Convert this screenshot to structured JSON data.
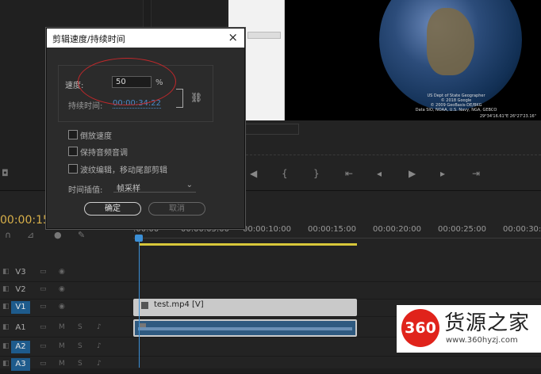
{
  "dialog": {
    "title": "剪辑速度/持续时间",
    "close": "×",
    "speed_label": "速度:",
    "speed_value": "50",
    "speed_unit": "%",
    "duration_label": "持续时间:",
    "duration_value": "00:00:34:22",
    "options": [
      {
        "label": "倒放速度",
        "checked": false
      },
      {
        "label": "保持音频音调",
        "checked": false
      },
      {
        "label": "波纹编辑，移动尾部剪辑",
        "checked": false
      }
    ],
    "interp_label": "时间插值:",
    "interp_value": "帧采样",
    "ok_label": "确定",
    "cancel_label": "取消"
  },
  "timeline": {
    "current_time": "00:00:15",
    "ruler": [
      ":00:00",
      "00:00:05:00",
      "00:00:10:00",
      "00:00:15:00",
      "00:00:20:00",
      "00:00:25:00",
      "00:00:30:00"
    ],
    "tracks": [
      {
        "name": "V3",
        "active": false
      },
      {
        "name": "V2",
        "active": false
      },
      {
        "name": "V1",
        "active": true
      },
      {
        "name": "A1",
        "active": false
      },
      {
        "name": "A2",
        "active": true
      },
      {
        "name": "A3",
        "active": true
      }
    ],
    "clip_label": "test.mp4 [V]"
  },
  "preview": {
    "credits": "US Dept of State Geographer\n© 2018 Google\n© 2009 GeoBasis-DE/BKG\nData SIO, NOAA, U.S. Navy, NGA, GEBCO",
    "coords": "29°34'16.61\"E 26°27'23.16\""
  },
  "watermark": {
    "badge": "360",
    "name": "货源之家",
    "url": "www.360hyzj.com"
  },
  "colors": {
    "accent": "#1e5b8c",
    "playhead": "#3b8fd6",
    "timecode": "#d8b04a",
    "highlight_oval": "#c0282b"
  }
}
